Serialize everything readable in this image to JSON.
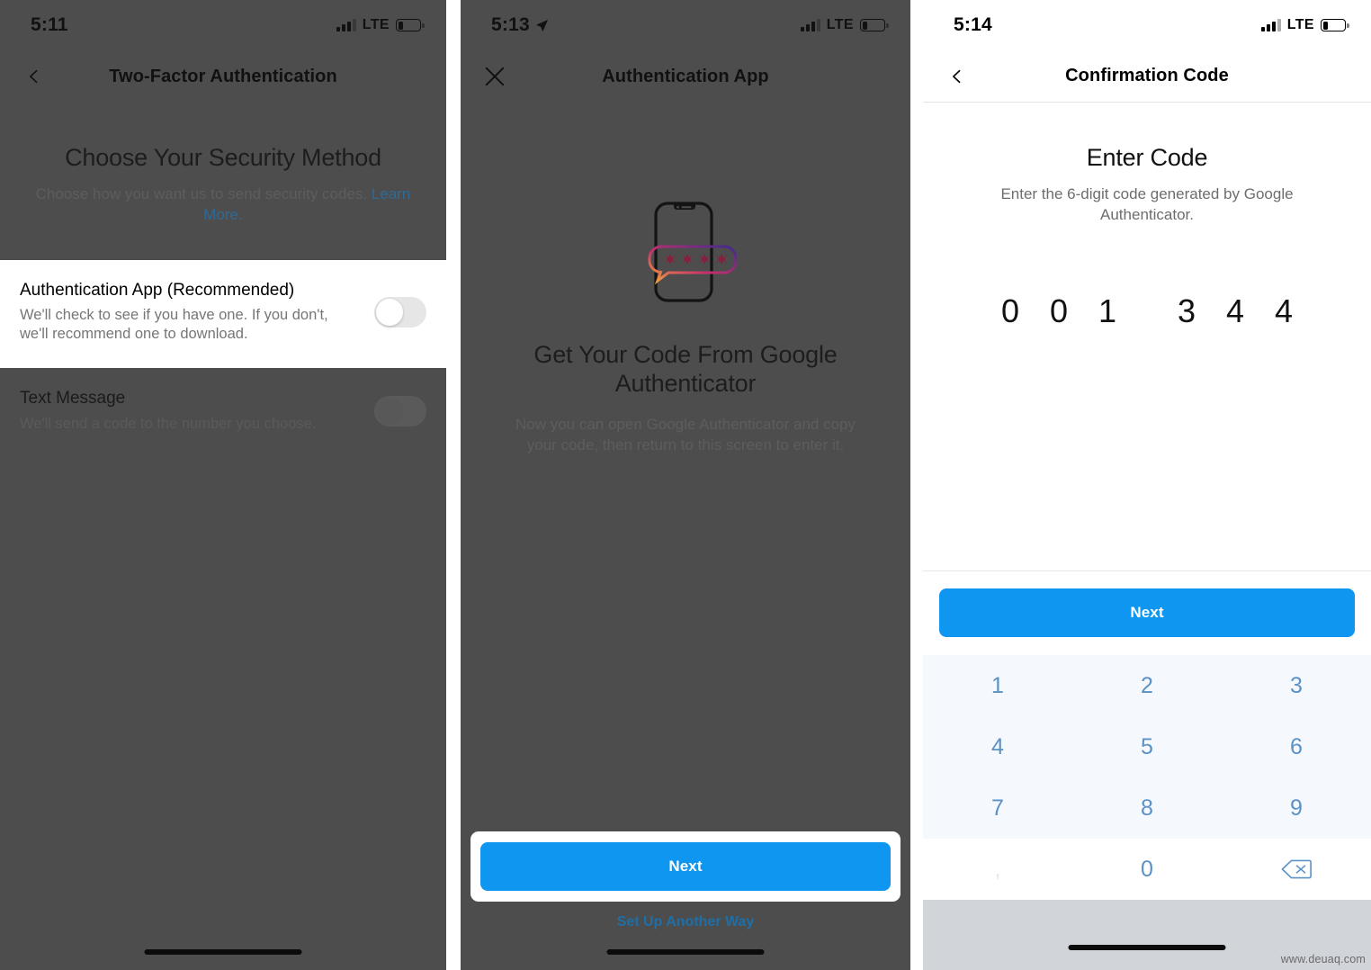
{
  "panels": [
    {
      "id": "choose-security-method",
      "status": {
        "time": "5:11",
        "carrier": "LTE",
        "location_arrow": false
      },
      "nav": {
        "back_icon": "chevron-left-icon",
        "title": "Two-Factor Authentication"
      },
      "hero": {
        "heading": "Choose Your Security Method",
        "body": "Choose how you want us to send security codes.",
        "link": "Learn More."
      },
      "options": [
        {
          "title": "Authentication App (Recommended)",
          "subtitle": "We'll check to see if you have one. If you don't, we'll recommend one to download.",
          "toggle_state": "off",
          "highlighted": true
        },
        {
          "title": "Text Message",
          "subtitle": "We'll send a code to the number you choose.",
          "toggle_state": "off",
          "highlighted": false
        }
      ]
    },
    {
      "id": "authentication-app",
      "status": {
        "time": "5:13",
        "carrier": "LTE",
        "location_arrow": true
      },
      "nav": {
        "back_icon": "close-x-icon",
        "title": "Authentication App"
      },
      "illustration": {
        "name": "phone-with-passcode-bubble-illustration",
        "bubble_chars": "✱✱✱✱"
      },
      "body": {
        "heading": "Get Your Code From Google Authenticator",
        "text": "Now you can open Google Authenticator and copy your code, then return to this screen to enter it."
      },
      "cta": {
        "primary_label": "Next",
        "secondary_label": "Set Up Another Way",
        "highlighted": true
      }
    },
    {
      "id": "confirmation-code",
      "status": {
        "time": "5:14",
        "carrier": "LTE",
        "location_arrow": false
      },
      "nav": {
        "back_icon": "chevron-left-icon",
        "title": "Confirmation Code"
      },
      "hero": {
        "heading": "Enter Code",
        "body": "Enter the 6-digit code generated by Google Authenticator."
      },
      "code": {
        "digits": [
          "0",
          "0",
          "1",
          "3",
          "4",
          "4"
        ]
      },
      "cta": {
        "primary_label": "Next"
      },
      "keypad": {
        "rows": [
          [
            "1",
            "2",
            "3"
          ],
          [
            "4",
            "5",
            "6"
          ],
          [
            "7",
            "8",
            "9"
          ],
          [
            ",",
            "0",
            "backspace-icon"
          ]
        ]
      }
    }
  ],
  "watermark": "www.deuaq.com",
  "colors": {
    "accent_blue": "#0f96f0",
    "link_blue": "#1e6fa8",
    "keypad_digit": "#5b91c4",
    "keypad_bg": "#f5f8fd",
    "dim_overlay": "#4d4d4d"
  }
}
